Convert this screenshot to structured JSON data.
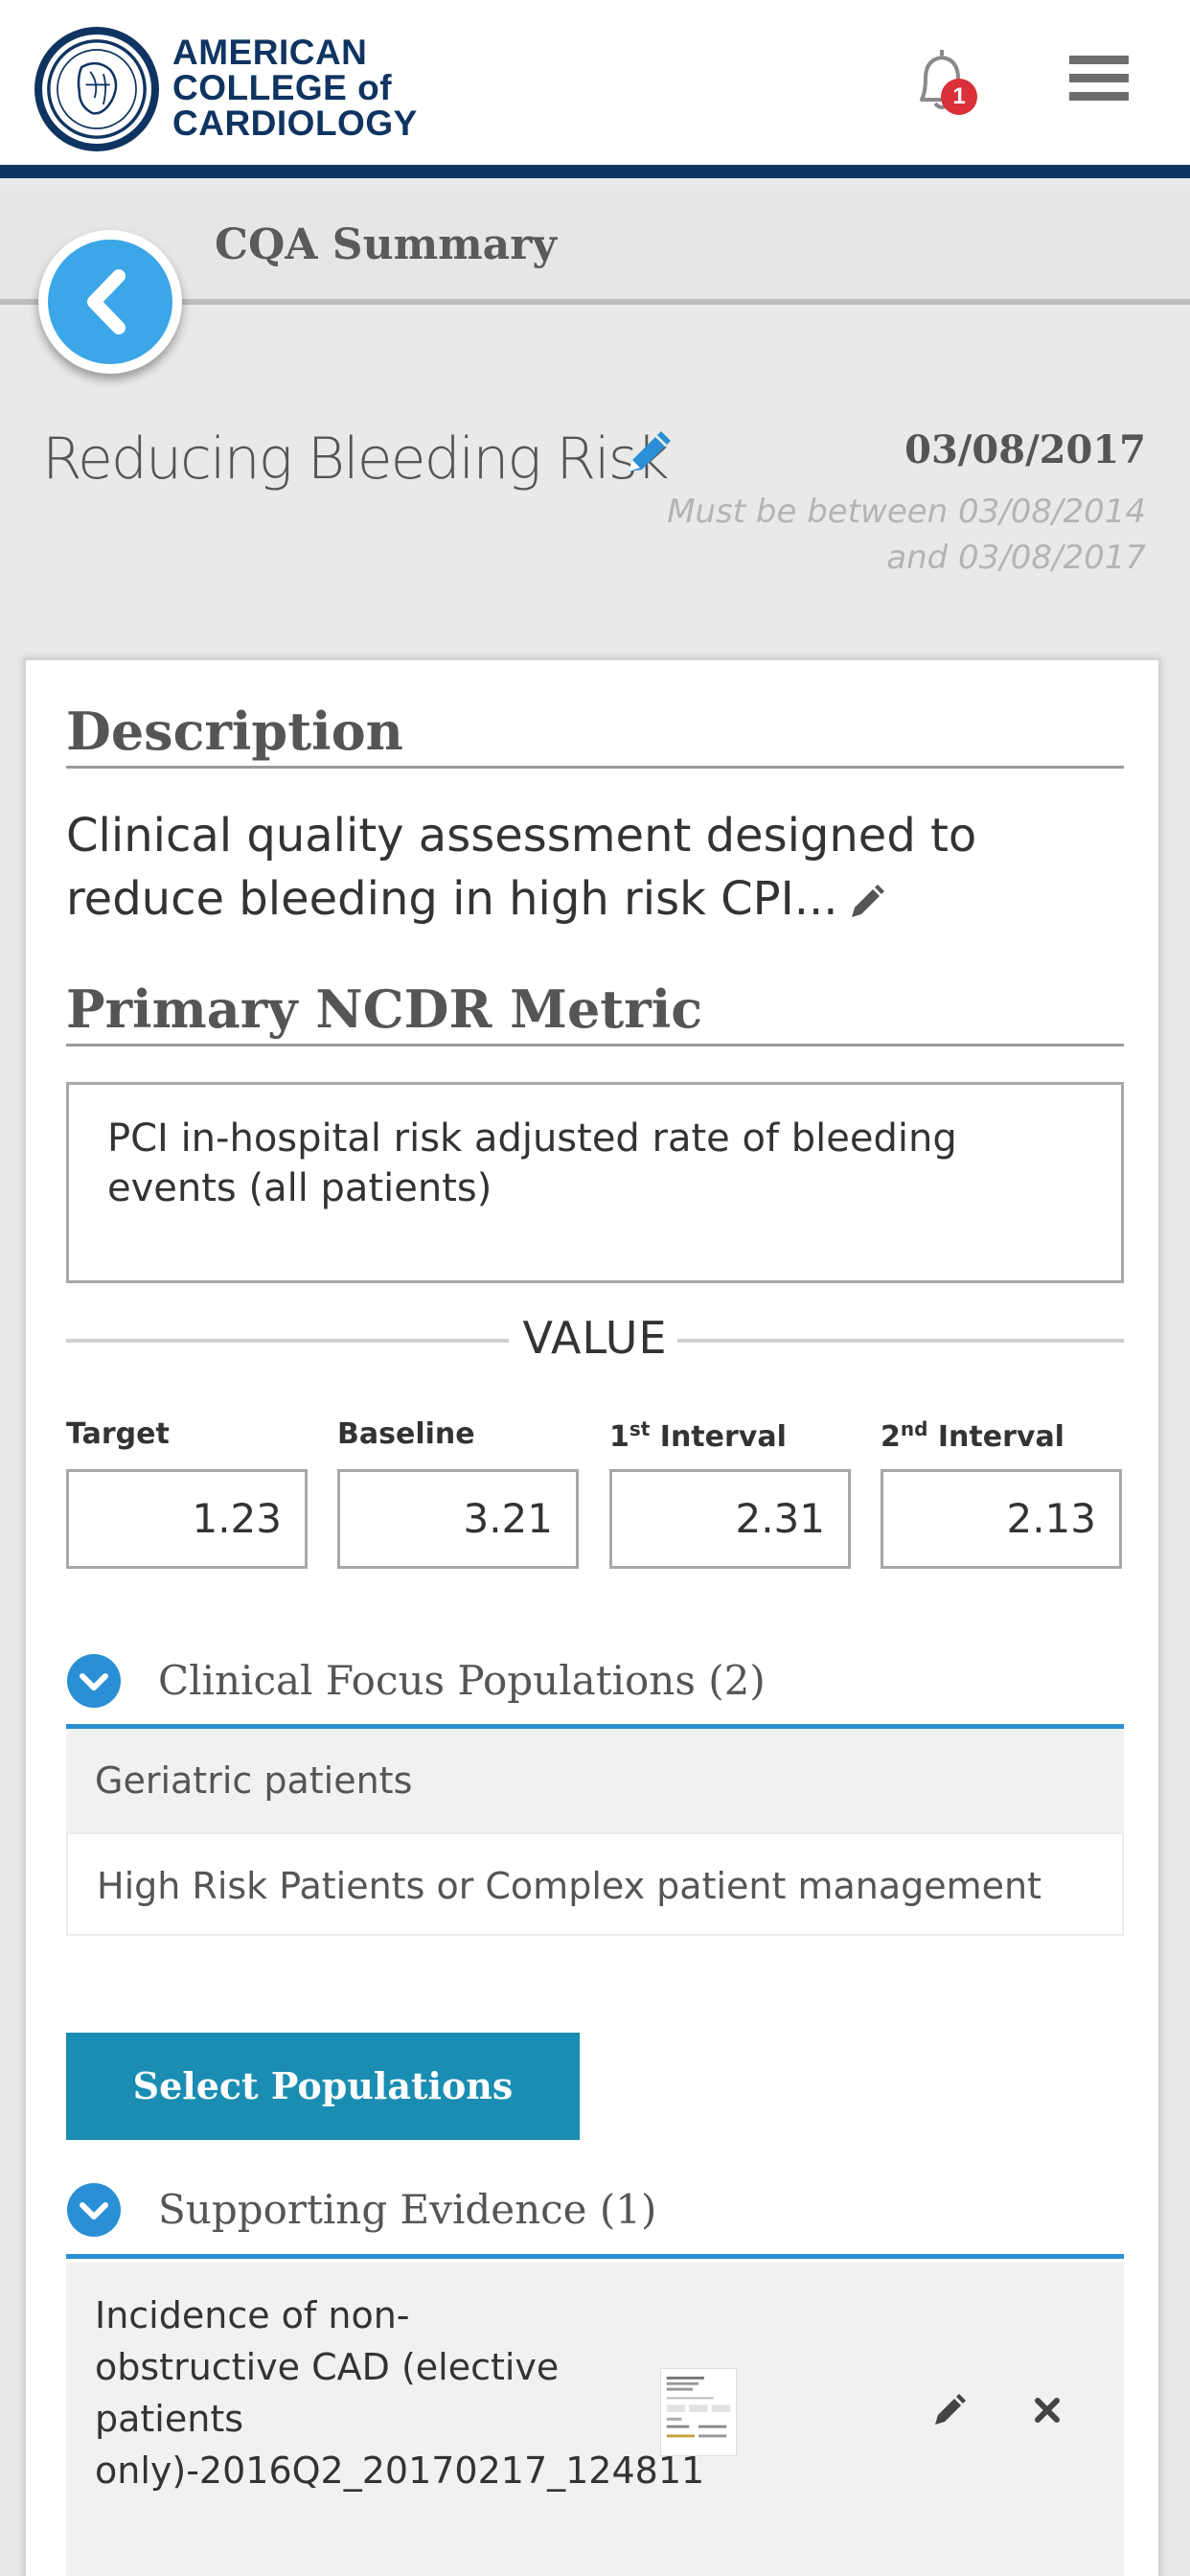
{
  "header": {
    "logo_lines": [
      "AMERICAN",
      "COLLEGE of",
      "CARDIOLOGY"
    ],
    "notification_count": "1",
    "menu_icon": "hamburger-icon",
    "bell_icon": "bell-icon",
    "brand_color": "#0f3461"
  },
  "titlebar": {
    "title": "CQA Summary",
    "back_icon": "chevron-left-icon"
  },
  "measure": {
    "title": "Reducing Bleeding Risk",
    "date": "03/08/2017",
    "date_hint": "Must be between 03/08/2014 and 03/08/2017"
  },
  "description": {
    "heading": "Description",
    "text": "Clinical quality assessment designed to reduce bleeding in high risk CPI..."
  },
  "metric": {
    "heading": "Primary NCDR Metric",
    "text": "PCI in-hospital risk adjusted rate of bleeding events (all patients)"
  },
  "values": {
    "heading": "VALUE",
    "columns": [
      {
        "label": "Target",
        "sup": "",
        "label_rest": "",
        "value": "1.23"
      },
      {
        "label": "Baseline",
        "sup": "",
        "label_rest": "",
        "value": "3.21"
      },
      {
        "label": "1",
        "sup": "st",
        "label_rest": " Interval",
        "value": "2.31"
      },
      {
        "label": "2",
        "sup": "nd",
        "label_rest": " Interval",
        "value": "2.13"
      }
    ]
  },
  "populations": {
    "heading": "Clinical Focus Populations (2)",
    "items": [
      "Geriatric patients",
      "High Risk Patients or Complex patient management"
    ],
    "button": "Select Populations"
  },
  "evidence": {
    "heading": "Supporting Evidence (1)",
    "items": [
      {
        "name": "Incidence of non-obstructive CAD (elective patients only)-2016Q2_20170217_124811"
      }
    ]
  },
  "colors": {
    "accent_blue": "#2a8fd4",
    "button_teal": "#1b8db3",
    "badge_red": "#d9303a"
  }
}
